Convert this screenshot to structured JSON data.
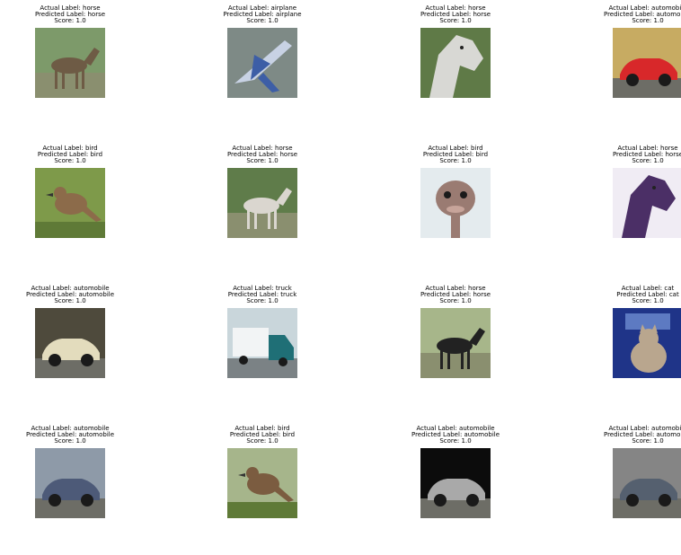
{
  "grid": [
    {
      "actual": "Actual Label: horse",
      "predicted": "Predicted Label: horse",
      "score": "Score: 1.0",
      "subject": "horse",
      "palette": [
        "#7d9a6a",
        "#6e5b45"
      ]
    },
    {
      "actual": "Actual Label: airplane",
      "predicted": "Predicted Label: airplane",
      "score": "Score: 1.0",
      "subject": "airplane",
      "palette": [
        "#7e8a86",
        "#c8d2e4"
      ]
    },
    {
      "actual": "Actual Label: horse",
      "predicted": "Predicted Label: horse",
      "score": "Score: 1.0",
      "subject": "horse-head",
      "palette": [
        "#5f7a47",
        "#d8d8d4"
      ]
    },
    {
      "actual": "Actual Label: automobile",
      "predicted": "Predicted Label: automobile",
      "score": "Score: 1.0",
      "subject": "car",
      "palette": [
        "#c7ab62",
        "#d8282a"
      ]
    },
    {
      "actual": "Actual Label: bird",
      "predicted": "Predicted Label: bird",
      "score": "Score: 1.0",
      "subject": "bird",
      "palette": [
        "#7e9a4a",
        "#8c6b4a"
      ]
    },
    {
      "actual": "Actual Label: horse",
      "predicted": "Predicted Label: horse",
      "score": "Score: 1.0",
      "subject": "horse",
      "palette": [
        "#5f7c4a",
        "#dad6cf"
      ]
    },
    {
      "actual": "Actual Label: bird",
      "predicted": "Predicted Label: bird",
      "score": "Score: 1.0",
      "subject": "ostrich",
      "palette": [
        "#e4ebee",
        "#9a7b72"
      ]
    },
    {
      "actual": "Actual Label: horse",
      "predicted": "Predicted Label: horse",
      "score": "Score: 1.0",
      "subject": "horse-head",
      "palette": [
        "#f0ecf4",
        "#4b2f66"
      ]
    },
    {
      "actual": "Actual Label: automobile",
      "predicted": "Predicted Label: automobile",
      "score": "Score: 1.0",
      "subject": "car",
      "palette": [
        "#4e4a3c",
        "#e3dcbd"
      ]
    },
    {
      "actual": "Actual Label: truck",
      "predicted": "Predicted Label: truck",
      "score": "Score: 1.0",
      "subject": "truck",
      "palette": [
        "#c9d6db",
        "#f2f4f5"
      ]
    },
    {
      "actual": "Actual Label: horse",
      "predicted": "Predicted Label: horse",
      "score": "Score: 1.0",
      "subject": "horse",
      "palette": [
        "#a7b68a",
        "#222222"
      ]
    },
    {
      "actual": "Actual Label: cat",
      "predicted": "Predicted Label: cat",
      "score": "Score: 1.0",
      "subject": "cat",
      "palette": [
        "#1f3488",
        "#b9a68e"
      ]
    },
    {
      "actual": "Actual Label: automobile",
      "predicted": "Predicted Label: automobile",
      "score": "Score: 1.0",
      "subject": "car",
      "palette": [
        "#8e9aa8",
        "#4d5a78"
      ]
    },
    {
      "actual": "Actual Label: bird",
      "predicted": "Predicted Label: bird",
      "score": "Score: 1.0",
      "subject": "bird",
      "palette": [
        "#a6b58b",
        "#7b5c40"
      ]
    },
    {
      "actual": "Actual Label: automobile",
      "predicted": "Predicted Label: automobile",
      "score": "Score: 1.0",
      "subject": "car",
      "palette": [
        "#0c0c0c",
        "#a9a9a9"
      ]
    },
    {
      "actual": "Actual Label: automobile",
      "predicted": "Predicted Label: automobile",
      "score": "Score: 1.0",
      "subject": "car",
      "palette": [
        "#858585",
        "#55606f"
      ]
    }
  ]
}
